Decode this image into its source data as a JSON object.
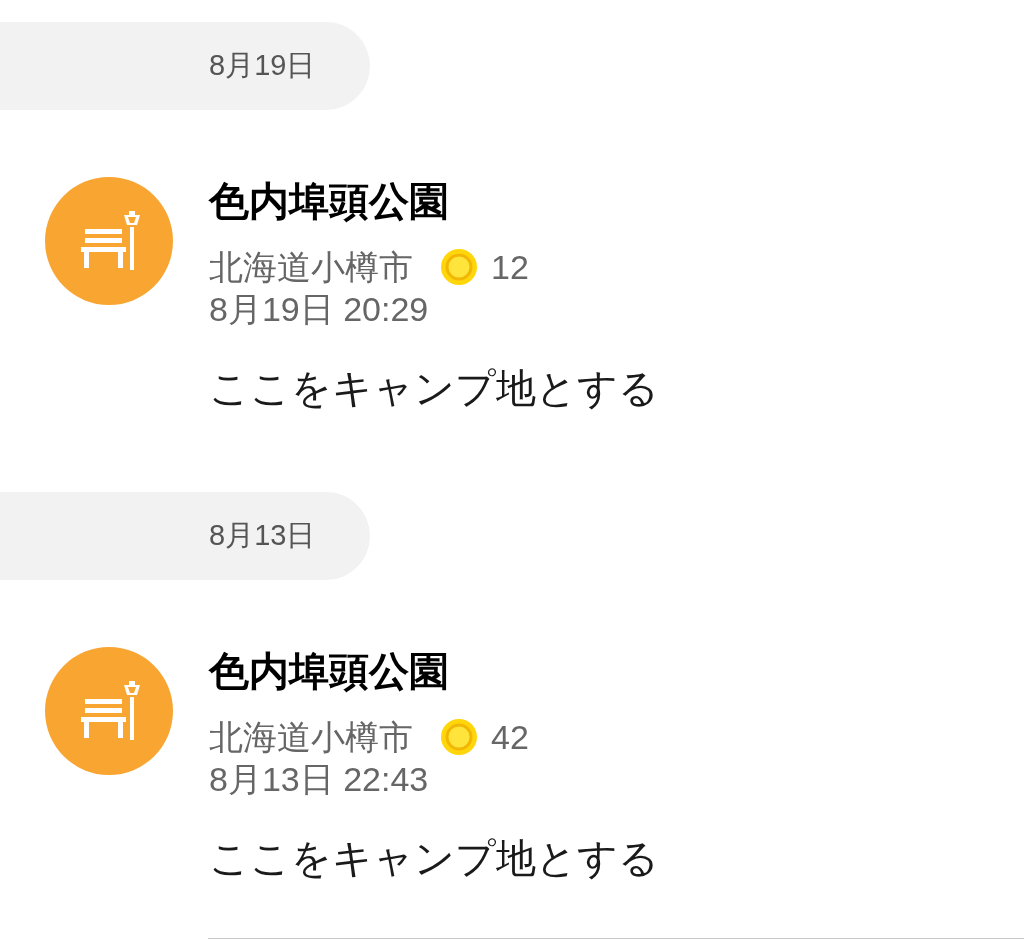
{
  "sections": [
    {
      "date_header": "8月19日",
      "checkins": [
        {
          "place": "色内埠頭公園",
          "location": "北海道小樽市",
          "points": "12",
          "datetime": "8月19日 20:29",
          "comment": "ここをキャンプ地とする"
        }
      ]
    },
    {
      "date_header": "8月13日",
      "checkins": [
        {
          "place": "色内埠頭公園",
          "location": "北海道小樽市",
          "points": "42",
          "datetime": "8月13日 22:43",
          "comment": "ここをキャンプ地とする"
        }
      ]
    }
  ]
}
